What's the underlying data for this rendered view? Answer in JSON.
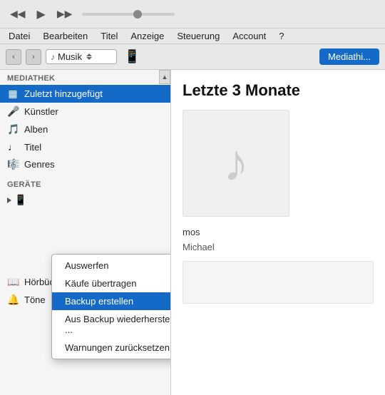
{
  "titlebar": {
    "play_icon": "▶",
    "rewind_icon": "◀◀",
    "forward_icon": "▶▶"
  },
  "menubar": {
    "items": [
      "Datei",
      "Bearbeiten",
      "Titel",
      "Anzeige",
      "Steuerung",
      "Account",
      "?"
    ]
  },
  "toolbar": {
    "back_label": "‹",
    "forward_label": "›",
    "music_note": "♪",
    "music_label": "Musik",
    "device_label": "📱",
    "mediathek_label": "Mediathi..."
  },
  "sidebar": {
    "library_title": "Mediathek",
    "library_items": [
      {
        "icon": "▦",
        "label": "Zuletzt hinzugefügt",
        "active": true
      },
      {
        "icon": "🎤",
        "label": "Künstler",
        "active": false
      },
      {
        "icon": "🎵",
        "label": "Alben",
        "active": false
      },
      {
        "icon": "♩",
        "label": "Titel",
        "active": false
      },
      {
        "icon": "🎼",
        "label": "Genres",
        "active": false
      }
    ],
    "devices_title": "Geräte",
    "device_name": "iPhone",
    "bottom_items": [
      {
        "icon": "♪",
        "label": "Hörbücher"
      },
      {
        "icon": "🔔",
        "label": "Töne"
      }
    ]
  },
  "context_menu": {
    "items": [
      {
        "label": "Auswerfen",
        "highlighted": false
      },
      {
        "label": "Käufe übertragen",
        "highlighted": false
      },
      {
        "label": "Backup erstellen",
        "highlighted": true
      },
      {
        "label": "Aus Backup wiederherstellen ...",
        "highlighted": false
      },
      {
        "label": "Warnungen zurücksetzen",
        "highlighted": false
      }
    ]
  },
  "content": {
    "title": "Letzte 3 Monate",
    "track1_title": "mos",
    "track1_artist": "Michael"
  }
}
